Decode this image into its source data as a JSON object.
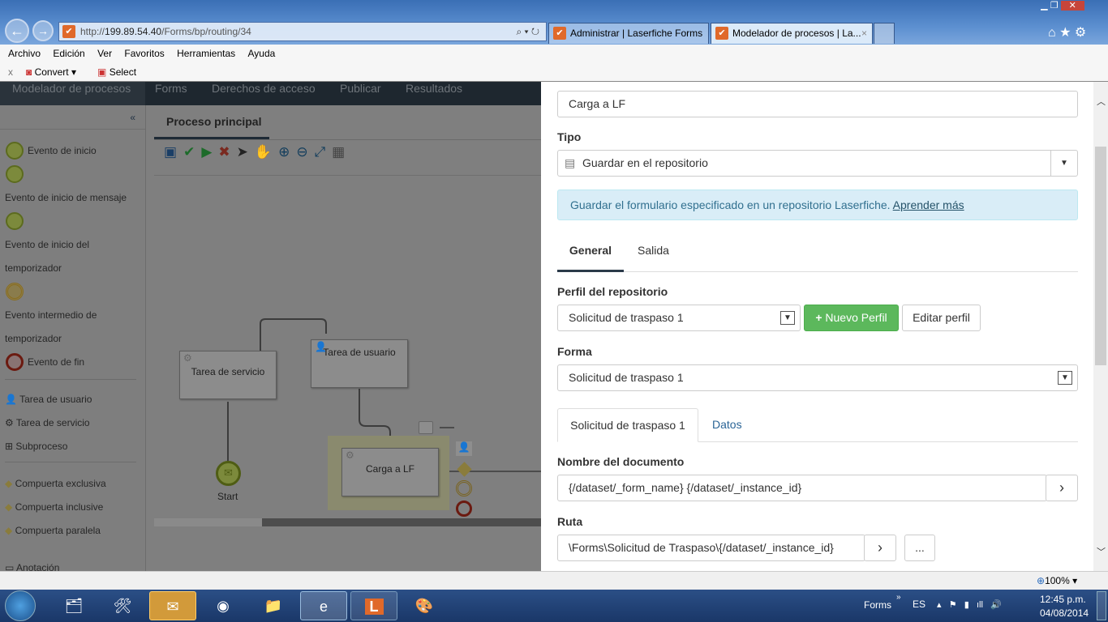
{
  "browser": {
    "url_prefix": "http://",
    "url_host": "199.89.54.40",
    "url_path": "/Forms/bp/routing/34",
    "tabs": [
      {
        "label": "Administrar | Laserfiche Forms"
      },
      {
        "label": "Modelador de procesos | La..."
      }
    ],
    "menu": [
      "Archivo",
      "Edición",
      "Ver",
      "Favoritos",
      "Herramientas",
      "Ayuda"
    ],
    "cmd": {
      "close": "x",
      "convert": "Convert",
      "select": "Select"
    },
    "zoom": "100%"
  },
  "appnav": [
    "Modelador de procesos",
    "Forms",
    "Derechos de acceso",
    "Publicar",
    "Resultados"
  ],
  "sidebar": {
    "collapse": "«",
    "items": [
      "Evento de inicio",
      "Evento de inicio de mensaje",
      "Evento de inicio del",
      "temporizador",
      "Evento intermedio de",
      "temporizador",
      "Evento de fin",
      "Tarea de usuario",
      "Tarea de servicio",
      "Subproceso",
      "Compuerta exclusiva",
      "Compuerta inclusive",
      "Compuerta paralela",
      "Anotación"
    ]
  },
  "canvas": {
    "tab": "Proceso principal",
    "nodes": {
      "service": "Tarea de servicio",
      "user": "Tarea de usuario",
      "upload": "Carga a LF",
      "start": "Start"
    }
  },
  "panel": {
    "name_value": "Carga a LF",
    "type_label": "Tipo",
    "type_value": "Guardar en el repositorio",
    "info": "Guardar el formulario especificado en un repositorio Laserfiche.",
    "info_link": "Aprender más",
    "tabs": [
      "General",
      "Salida"
    ],
    "profile_label": "Perfil del repositorio",
    "profile_value": "Solicitud de traspaso 1",
    "new_profile": "Nuevo Perfil",
    "edit_profile": "Editar perfil",
    "form_label": "Forma",
    "form_value": "Solicitud de traspaso 1",
    "subtabs": [
      "Solicitud de traspaso 1",
      "Datos"
    ],
    "docname_label": "Nombre del documento",
    "docname_value": "{/dataset/_form_name} {/dataset/_instance_id}",
    "path_label": "Ruta",
    "path_value": "\\Forms\\Solicitud de Traspaso\\{/dataset/_instance_id}",
    "browse": "...",
    "arrow": "›"
  },
  "taskbar": {
    "forms": "Forms",
    "lang": "ES",
    "time": "12:45 p.m.",
    "date": "04/08/2014",
    "more": "»"
  },
  "colors": {
    "green": "#5cb85c",
    "info_bg": "#d9edf7",
    "link": "#2a6496"
  }
}
